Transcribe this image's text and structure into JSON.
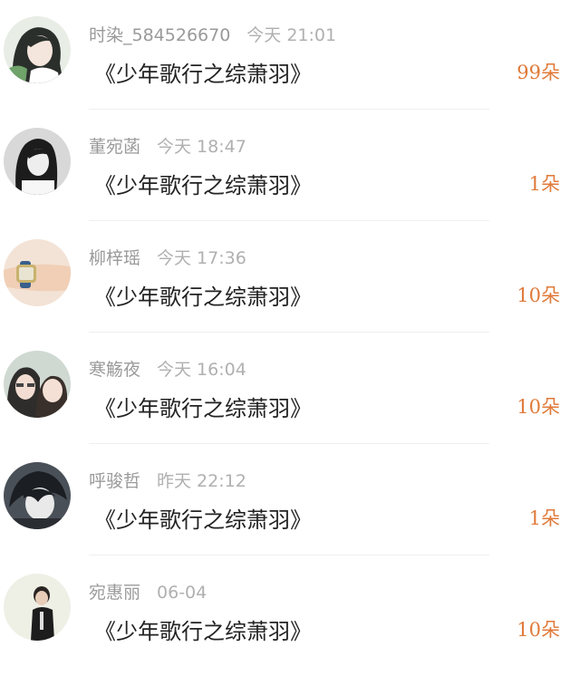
{
  "colors": {
    "accent": "#e07a3a",
    "name": "#9a9a9a",
    "title": "#222222"
  },
  "items": [
    {
      "user": "时染_584526670",
      "time": "今天 21:01",
      "book": "《少年歌行之综萧羽》",
      "gift": "99朵",
      "avatar_icon": "anime-swordsman-avatar"
    },
    {
      "user": "董宛菡",
      "time": "今天 18:47",
      "book": "《少年歌行之综萧羽》",
      "gift": "1朵",
      "avatar_icon": "bw-girl-avatar"
    },
    {
      "user": "柳梓瑶",
      "time": "今天 17:36",
      "book": "《少年歌行之综萧羽》",
      "gift": "10朵",
      "avatar_icon": "wristwatch-avatar"
    },
    {
      "user": "寒觞夜",
      "time": "今天 16:04",
      "book": "《少年歌行之综萧羽》",
      "gift": "10朵",
      "avatar_icon": "two-girls-avatar"
    },
    {
      "user": "呼骏哲",
      "time": "昨天 22:12",
      "book": "《少年歌行之综萧羽》",
      "gift": "1朵",
      "avatar_icon": "anime-boy-avatar"
    },
    {
      "user": "宛惠丽",
      "time": "06-04",
      "book": "《少年歌行之综萧羽》",
      "gift": "10朵",
      "avatar_icon": "person-black-jacket-avatar"
    }
  ]
}
